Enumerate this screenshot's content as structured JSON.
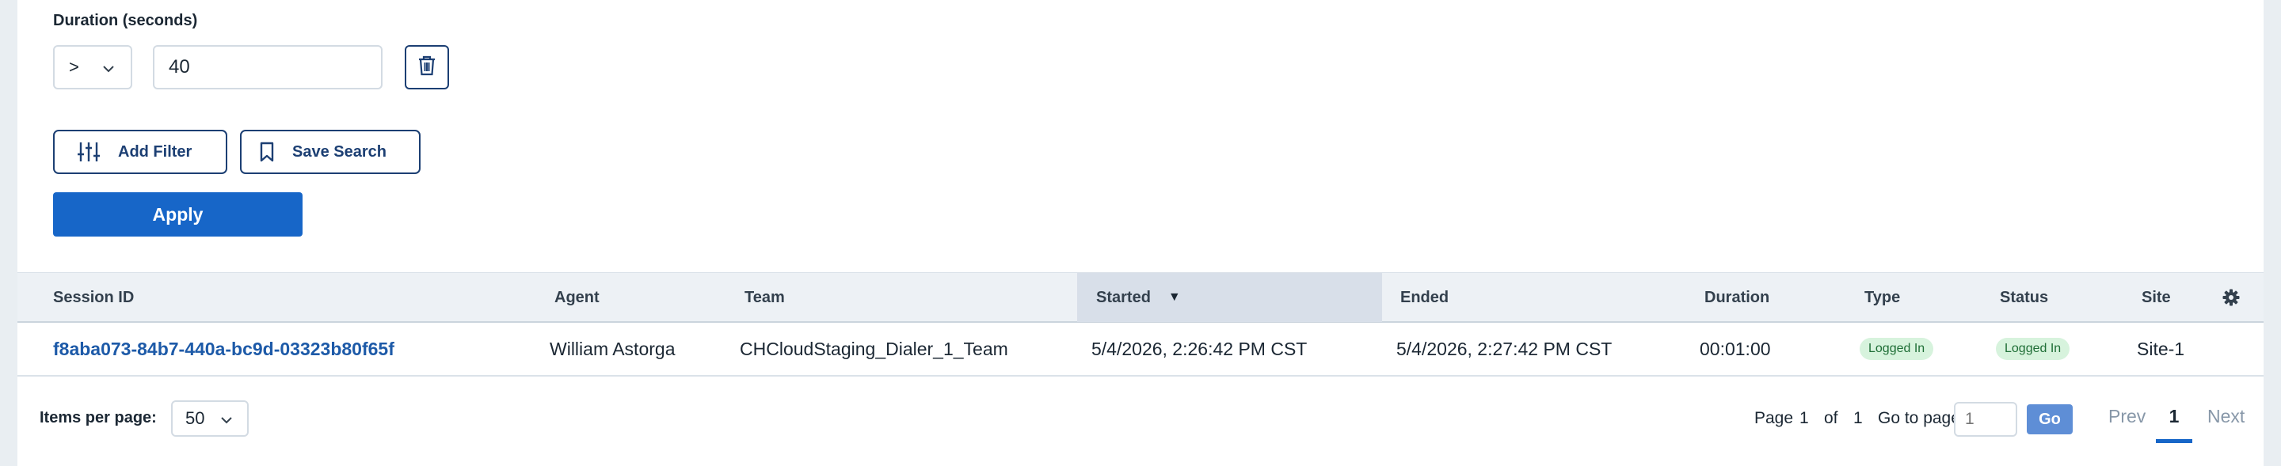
{
  "filter": {
    "label": "Duration (seconds)",
    "operator": ">",
    "value": "40",
    "add_filter_label": "Add Filter",
    "save_search_label": "Save Search",
    "apply_label": "Apply"
  },
  "table": {
    "columns": {
      "session_id": "Session ID",
      "agent": "Agent",
      "team": "Team",
      "started": "Started",
      "ended": "Ended",
      "duration": "Duration",
      "type": "Type",
      "status": "Status",
      "site": "Site"
    },
    "sort": {
      "column": "Started",
      "direction": "descending"
    },
    "rows": [
      {
        "session_id": "f8aba073-84b7-440a-bc9d-03323b80f65f",
        "agent": "William Astorga",
        "team": "CHCloudStaging_Dialer_1_Team",
        "started": "5/4/2026, 2:26:42 PM CST",
        "ended": "5/4/2026, 2:27:42 PM CST",
        "duration": "00:01:00",
        "type": "Logged In",
        "status": "Logged In",
        "site": "Site-1"
      }
    ]
  },
  "pagination": {
    "items_per_page_label": "Items per page:",
    "items_per_page": "50",
    "page_label": "Page",
    "page_current": "1",
    "of_label": "of",
    "page_total": "1",
    "goto_label": "Go to page:",
    "goto_placeholder": "1",
    "go_label": "Go",
    "prev_label": "Prev",
    "current_page_link": "1",
    "next_label": "Next"
  },
  "colors": {
    "primary": "#1766c8",
    "navy": "#1c3f73",
    "badge_bg": "#d7f3dd",
    "badge_text": "#1f6e36"
  }
}
